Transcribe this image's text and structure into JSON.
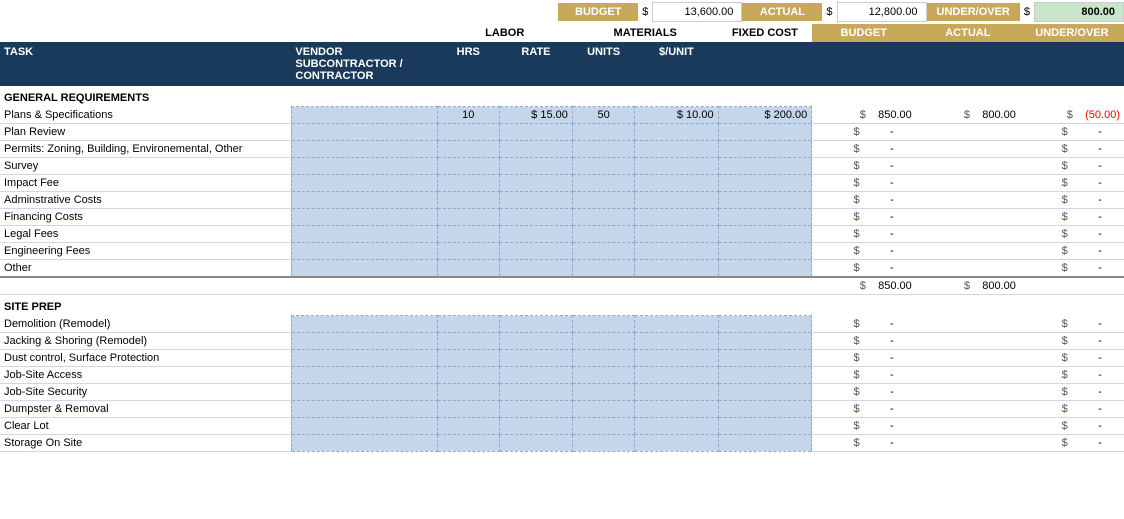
{
  "summary": {
    "budget_label": "BUDGET",
    "actual_label": "ACTUAL",
    "underover_label": "UNDER/OVER",
    "budget_dollar": "$",
    "budget_value": "13,600.00",
    "actual_dollar": "$",
    "actual_value": "12,800.00",
    "uo_dollar": "$",
    "uo_value": "800.00"
  },
  "columns": {
    "task": "TASK",
    "vendor": "VENDOR\nSUBCONTRACTOR /\nCONTRACTOR",
    "vendor_line1": "VENDOR",
    "vendor_line2": "SUBCONTRACTOR /",
    "vendor_line3": "CONTRACTOR",
    "labor": "LABOR",
    "materials": "MATERIALS",
    "fixed_cost": "FIXED COST",
    "budget": "BUDGET",
    "actual": "ACTUAL",
    "underover": "UNDER/OVER",
    "hrs": "HRS",
    "rate": "RATE",
    "units": "UNITS",
    "per_unit": "$/UNIT"
  },
  "sections": [
    {
      "title": "GENERAL REQUIREMENTS",
      "rows": [
        {
          "task": "Plans & Specifications",
          "hrs": "10",
          "rate": "$ 15.00",
          "units": "50",
          "per_unit": "$ 10.00",
          "fixed": "$ 200.00",
          "budget_dollar": "$",
          "budget": "850.00",
          "actual_dollar": "$",
          "actual": "800.00",
          "uo_dollar": "$",
          "uo": "(50.00)",
          "uo_type": "negative"
        },
        {
          "task": "Plan Review",
          "budget_dollar": "$",
          "budget": "-",
          "uo_dollar": "$",
          "uo": "-",
          "uo_type": "normal"
        },
        {
          "task": "Permits: Zoning, Building, Environemental, Other",
          "budget_dollar": "$",
          "budget": "-",
          "uo_dollar": "$",
          "uo": "-",
          "uo_type": "normal"
        },
        {
          "task": "Survey",
          "budget_dollar": "$",
          "budget": "-",
          "uo_dollar": "$",
          "uo": "-",
          "uo_type": "normal"
        },
        {
          "task": "Impact Fee",
          "budget_dollar": "$",
          "budget": "-",
          "uo_dollar": "$",
          "uo": "-",
          "uo_type": "normal"
        },
        {
          "task": "Adminstrative Costs",
          "budget_dollar": "$",
          "budget": "-",
          "uo_dollar": "$",
          "uo": "-",
          "uo_type": "normal"
        },
        {
          "task": "Financing Costs",
          "budget_dollar": "$",
          "budget": "-",
          "uo_dollar": "$",
          "uo": "-",
          "uo_type": "normal"
        },
        {
          "task": "Legal Fees",
          "budget_dollar": "$",
          "budget": "-",
          "uo_dollar": "$",
          "uo": "-",
          "uo_type": "normal"
        },
        {
          "task": "Engineering Fees",
          "budget_dollar": "$",
          "budget": "-",
          "uo_dollar": "$",
          "uo": "-",
          "uo_type": "normal"
        },
        {
          "task": "Other",
          "budget_dollar": "$",
          "budget": "-",
          "uo_dollar": "$",
          "uo": "-",
          "uo_type": "normal"
        }
      ],
      "subtotal": {
        "budget_dollar": "$",
        "budget": "850.00",
        "actual_dollar": "$",
        "actual": "800.00"
      }
    },
    {
      "title": "SITE PREP",
      "rows": [
        {
          "task": "Demolition (Remodel)",
          "budget_dollar": "$",
          "budget": "-",
          "uo_dollar": "$",
          "uo": "-",
          "uo_type": "normal"
        },
        {
          "task": "Jacking & Shoring (Remodel)",
          "budget_dollar": "$",
          "budget": "-",
          "uo_dollar": "$",
          "uo": "-",
          "uo_type": "normal"
        },
        {
          "task": "Dust control, Surface Protection",
          "budget_dollar": "$",
          "budget": "-",
          "uo_dollar": "$",
          "uo": "-",
          "uo_type": "normal"
        },
        {
          "task": "Job-Site Access",
          "budget_dollar": "$",
          "budget": "-",
          "uo_dollar": "$",
          "uo": "-",
          "uo_type": "normal"
        },
        {
          "task": "Job-Site Security",
          "budget_dollar": "$",
          "budget": "-",
          "uo_dollar": "$",
          "uo": "-",
          "uo_type": "normal"
        },
        {
          "task": "Dumpster & Removal",
          "budget_dollar": "$",
          "budget": "-",
          "uo_dollar": "$",
          "uo": "-",
          "uo_type": "normal"
        },
        {
          "task": "Clear Lot",
          "budget_dollar": "$",
          "budget": "-",
          "uo_dollar": "$",
          "uo": "-",
          "uo_type": "normal"
        },
        {
          "task": "Storage On Site",
          "budget_dollar": "$",
          "budget": "-",
          "uo_dollar": "$",
          "uo": "-",
          "uo_type": "normal"
        }
      ]
    }
  ]
}
